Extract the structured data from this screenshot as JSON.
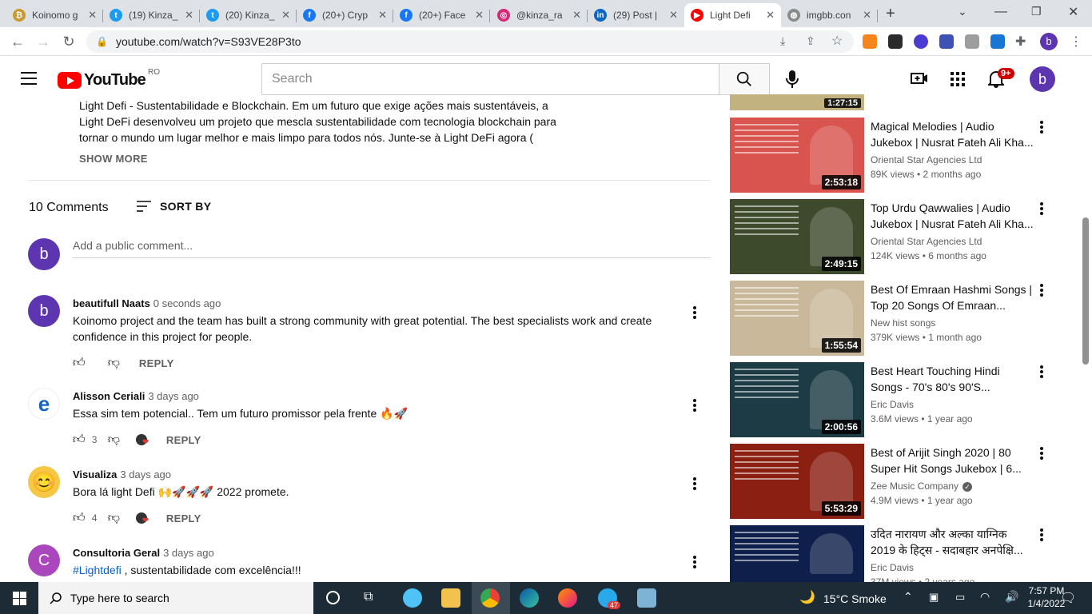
{
  "browser": {
    "tabs": [
      {
        "title": "Koinomo g",
        "color": "#c99a2e",
        "glyph": "₿"
      },
      {
        "title": "(19) Kinza_",
        "color": "#1d9bf0",
        "glyph": "t"
      },
      {
        "title": "(20) Kinza_",
        "color": "#1d9bf0",
        "glyph": "t"
      },
      {
        "title": "(20+) Cryp",
        "color": "#1877f2",
        "glyph": "f"
      },
      {
        "title": "(20+) Face",
        "color": "#1877f2",
        "glyph": "f"
      },
      {
        "title": "@kinza_ra",
        "color": "#d62976",
        "glyph": "◎"
      },
      {
        "title": "(29) Post |",
        "color": "#0a66c2",
        "glyph": "in"
      },
      {
        "title": "Light Defi",
        "color": "#ff0000",
        "glyph": "▶"
      },
      {
        "title": "imgbb.con",
        "color": "#8a8a8a",
        "glyph": "◍"
      }
    ],
    "url": "youtube.com/watch?v=S93VE28P3to"
  },
  "youtube": {
    "logo": "YouTube",
    "region": "RO",
    "search_placeholder": "Search",
    "notif_count": "9+",
    "user_initial": "b"
  },
  "description": {
    "line1": "Light Defi - Sustentabilidade e Blockchain. Em um futuro que exige ações mais sustentáveis, a",
    "line2": "Light DeFi desenvolveu um projeto que mescla sustentabilidade com tecnologia blockchain para",
    "line3": "tornar o mundo um lugar melhor e mais limpo para todos nós.  Junte-se à Light DeFi agora (",
    "show_more": "SHOW MORE"
  },
  "comments_header": {
    "count": "10 Comments",
    "sort_by": "SORT BY",
    "add_placeholder": "Add a public comment...",
    "user_initial": "b"
  },
  "comments": [
    {
      "author": "beautifull Naats",
      "time": "0 seconds ago",
      "text": "Koinomo project and the team has built a strong community with great potential. The best specialists work and create confidence in this project for people.",
      "likes": "",
      "reply": "REPLY",
      "initial": "b",
      "color": "#5e35b1"
    },
    {
      "author": "Alisson Ceriali",
      "time": "3 days ago",
      "text": "Essa sim tem potencial.. Tem um futuro promissor pela frente 🔥🚀",
      "likes": "3",
      "reply": "REPLY",
      "initial": "e",
      "color": "#ffffff"
    },
    {
      "author": "Visualiza",
      "time": "3 days ago",
      "text": "Bora lá light Defi 🙌🚀🚀🚀 2022 promete.",
      "likes": "4",
      "reply": "REPLY",
      "initial": "😊",
      "color": "#f6c744"
    },
    {
      "author": "Consultoria Geral",
      "time": "3 days ago",
      "hashtag": "#Lightdefi",
      "text": " , sustentabilidade com excelência!!!",
      "likes": "",
      "reply": "REPLY",
      "initial": "C",
      "color": "#ab47bc"
    }
  ],
  "sidebar": [
    {
      "title": "Magical Melodies | Audio Jukebox | Nusrat Fateh Ali Kha...",
      "channel": "Oriental Star Agencies Ltd",
      "meta": "89K views • 2 months ago",
      "duration": "2:53:18",
      "bg": "#d9534f"
    },
    {
      "title": "Top Urdu Qawwalies | Audio Jukebox | Nusrat Fateh Ali Kha...",
      "channel": "Oriental Star Agencies Ltd",
      "meta": "124K views • 6 months ago",
      "duration": "2:49:15",
      "bg": "#3d4a2c"
    },
    {
      "title": "Best Of Emraan Hashmi Songs | Top 20 Songs Of Emraan...",
      "channel": "New hist songs",
      "meta": "379K views • 1 month ago",
      "duration": "1:55:54",
      "bg": "#c9b99a"
    },
    {
      "title": "Best Heart Touching Hindi Songs - 70's 80's 90'S...",
      "channel": "Eric Davis",
      "meta": "3.6M views • 1 year ago",
      "duration": "2:00:56",
      "bg": "#1d3b44"
    },
    {
      "title": "Best of Arijit Singh 2020 | 80 Super Hit Songs Jukebox | 6...",
      "channel": "Zee Music Company",
      "meta": "4.9M views • 1 year ago",
      "duration": "5:53:29",
      "bg": "#8a1f12"
    },
    {
      "title": "उदित नारायण और अल्का याग्निक 2019 के हिट्स - सदाबहार अनपेक्षि...",
      "channel": "Eric Davis",
      "meta": "37M views • 2 years ago",
      "duration": "",
      "bg": "#0d1f4a"
    }
  ],
  "taskbar": {
    "search_placeholder": "Type here to search",
    "weather": "15°C  Smoke",
    "time": "7:57 PM",
    "date": "1/4/2022",
    "telegram_badge": "47"
  }
}
